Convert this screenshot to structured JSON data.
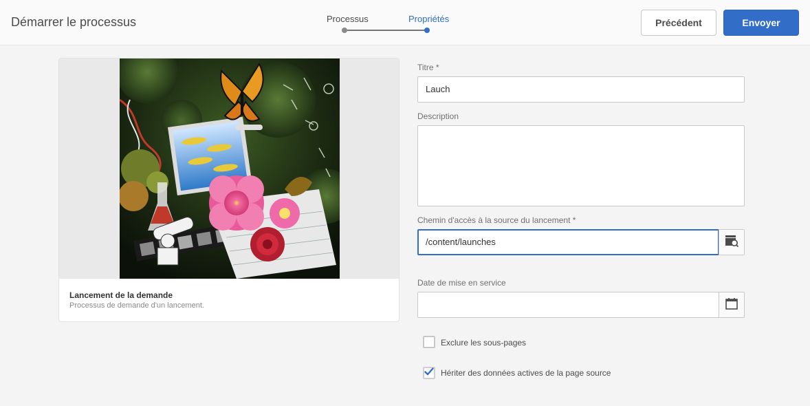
{
  "header": {
    "title": "Démarrer le processus",
    "steps": [
      {
        "label": "Processus",
        "state": "done"
      },
      {
        "label": "Propriétés",
        "state": "active"
      }
    ],
    "prev_label": "Précédent",
    "submit_label": "Envoyer"
  },
  "card": {
    "title": "Lancement de la demande",
    "subtitle": "Processus de demande d'un lancement."
  },
  "form": {
    "title_label": "Titre *",
    "title_value": "Lauch",
    "description_label": "Description",
    "description_value": "",
    "path_label": "Chemin d'accès à la source du lancement *",
    "path_value": "/content/launches",
    "date_label": "Date de mise en service",
    "date_value": "",
    "exclude_label": "Exclure les sous-pages",
    "exclude_checked": false,
    "inherit_label": "Hériter des données actives de la page source",
    "inherit_checked": true
  },
  "colors": {
    "accent": "#326ec8",
    "background": "#f4f4f4"
  },
  "icons": {
    "path_browse": "folder-search-icon",
    "date_picker": "calendar-icon",
    "checkmark": "checkmark-icon"
  }
}
